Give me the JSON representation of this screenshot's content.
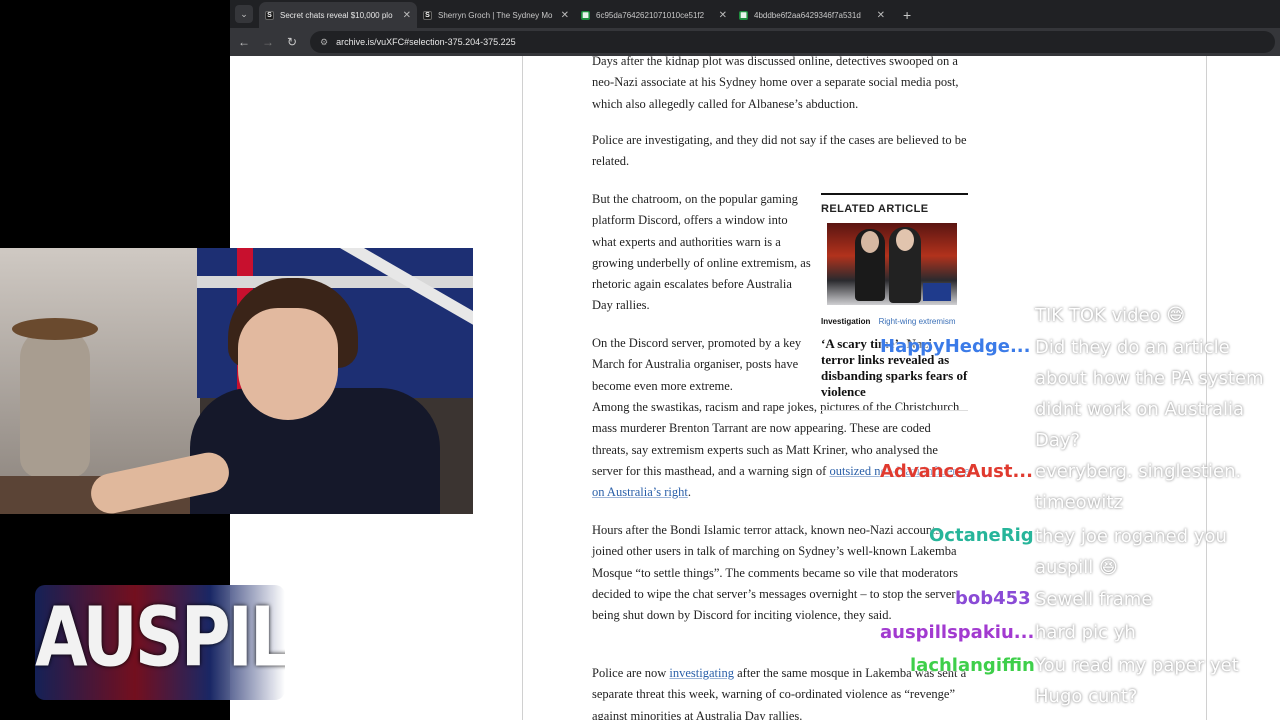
{
  "browser": {
    "tabs": [
      {
        "title": "Secret chats reveal $10,000 plo",
        "favicon": "S",
        "active": true
      },
      {
        "title": "Sherryn Groch | The Sydney Mo",
        "favicon": "S",
        "active": false
      },
      {
        "title": "6c95da7642621071010ce51f2",
        "favicon": "grid",
        "active": false
      },
      {
        "title": "4bddbe6f2aa6429346f7a531d",
        "favicon": "grid",
        "active": false
      }
    ],
    "new_tab": "+",
    "tab_menu": "⌄",
    "url": "archive.is/vuXFC#selection-375.204-375.225"
  },
  "article": {
    "p1": "Days after the kidnap plot was discussed online, detectives swooped on a neo-Nazi associate at his Sydney home over a separate social media post, which also allegedly called for Albanese’s abduction.",
    "p2": "Police are investigating, and they did not say if the cases are believed to be related.",
    "p3": "But the chatroom, on the popular gaming platform Discord, offers a window into what experts and authorities warn is a growing underbelly of online extremism, as rhetoric again escalates before Australia Day rallies.",
    "p4a": "On the Discord server, promoted by a key March for Australia organiser, posts have become even more extreme.",
    "p4b": "Among the swastikas, racism and rape jokes, pictures of the Christchurch mass murderer Brenton Tarrant are now appearing. These are coded threats, say extremism experts such as Matt Kriner, who analysed the server for this masthead, and a warning sign of ",
    "p4_link": "outsized neo-Nazi influence on Australia’s right",
    "p4_end": ".",
    "p5": "Hours after the Bondi Islamic terror attack, known neo-Nazi accounts joined other users in talk of marching on Sydney’s well-known Lakemba Mosque “to settle things”. The comments became so vile that moderators decided to wipe the chat server’s messages overnight – to stop the server being shut down by Discord for inciting violence, they said.",
    "p6_start": "Police are now ",
    "p6_link": "investigating",
    "p6_rest": " after the same mosque in Lakemba was sent a separate threat this week, warning of co-ordinated violence as “revenge” against minorities at Australia Day rallies."
  },
  "related": {
    "heading": "RELATED ARTICLE",
    "tag_primary": "Investigation",
    "tag_secondary": "Right-wing extremism",
    "title": "‘A scary time’: Nazi terror links revealed as disbanding sparks fears of violence"
  },
  "overlay": {
    "logo_text": "AUSPILL",
    "chat_names": [
      {
        "name": "HappyHedge...",
        "color": "#3b7be8"
      },
      {
        "name": "AdvanceAust...",
        "color": "#e03a2f"
      },
      {
        "name": "OctaneRig",
        "color": "#27b59a"
      },
      {
        "name": "bob453",
        "color": "#8a4bd6"
      },
      {
        "name": "auspillspakiu...",
        "color": "#a23ad0"
      },
      {
        "name": "lachlangiffin",
        "color": "#3ecf4a"
      }
    ],
    "chat_messages": [
      "TIK TOK video 😅",
      "Did they do an article about how the PA system didnt work on Australia Day?",
      "everyberg. singlestien. timeowitz",
      "they joe roganed you auspill 😆",
      "Sewell frame",
      "hard pic yh",
      "You read my paper yet Hugo cunt?"
    ]
  }
}
